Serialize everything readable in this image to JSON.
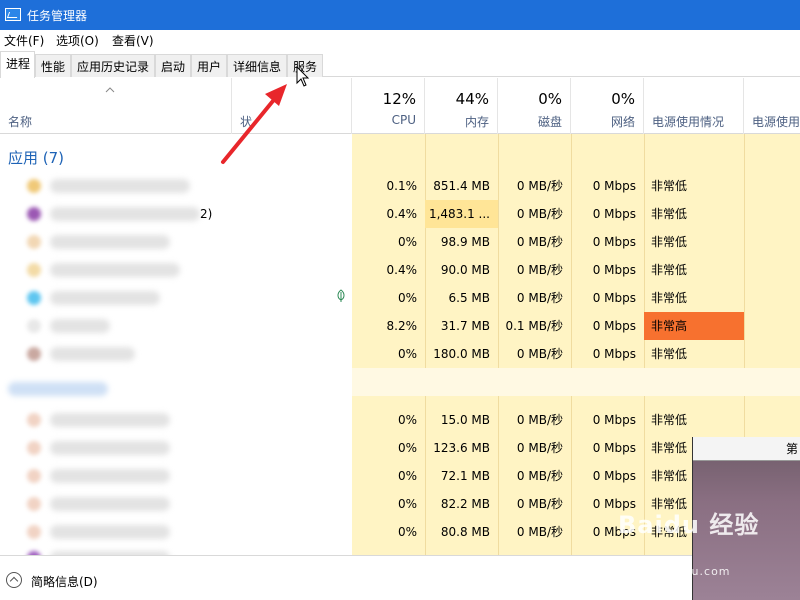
{
  "window": {
    "title": "任务管理器"
  },
  "menu": [
    "文件(F)",
    "选项(O)",
    "查看(V)"
  ],
  "tabs": [
    "进程",
    "性能",
    "应用历史记录",
    "启动",
    "用户",
    "详细信息",
    "服务"
  ],
  "header": {
    "name": "名称",
    "status": "状",
    "cpu_pct": "12%",
    "cpu": "CPU",
    "mem_pct": "44%",
    "mem": "内存",
    "disk_pct": "0%",
    "disk": "磁盘",
    "net_pct": "0%",
    "net": "网络",
    "power": "电源使用情况",
    "power_trend": "电源使用"
  },
  "group": {
    "title": "应用 (7)"
  },
  "name_fragment": "2)",
  "rows": [
    {
      "cpu": "0.1%",
      "mem": "851.4 MB",
      "disk": "0 MB/秒",
      "net": "0 Mbps",
      "power": "非常低"
    },
    {
      "cpu": "0.4%",
      "mem": "1,483.1 ...",
      "disk": "0 MB/秒",
      "net": "0 Mbps",
      "power": "非常低"
    },
    {
      "cpu": "0%",
      "mem": "98.9 MB",
      "disk": "0 MB/秒",
      "net": "0 Mbps",
      "power": "非常低"
    },
    {
      "cpu": "0.4%",
      "mem": "90.0 MB",
      "disk": "0 MB/秒",
      "net": "0 Mbps",
      "power": "非常低"
    },
    {
      "cpu": "0%",
      "mem": "6.5 MB",
      "disk": "0 MB/秒",
      "net": "0 Mbps",
      "power": "非常低"
    },
    {
      "cpu": "8.2%",
      "mem": "31.7 MB",
      "disk": "0.1 MB/秒",
      "net": "0 Mbps",
      "power": "非常高"
    },
    {
      "cpu": "0%",
      "mem": "180.0 MB",
      "disk": "0 MB/秒",
      "net": "0 Mbps",
      "power": "非常低"
    }
  ],
  "rows2": [
    {
      "cpu": "0%",
      "mem": "15.0 MB",
      "disk": "0 MB/秒",
      "net": "0 Mbps",
      "power": "非常低"
    },
    {
      "cpu": "0%",
      "mem": "123.6 MB",
      "disk": "0 MB/秒",
      "net": "0 Mbps",
      "power": "非常低"
    },
    {
      "cpu": "0%",
      "mem": "72.1 MB",
      "disk": "0 MB/秒",
      "net": "0 Mbps",
      "power": "非常低"
    },
    {
      "cpu": "0%",
      "mem": "82.2 MB",
      "disk": "0 MB/秒",
      "net": "0 Mbps",
      "power": "非常低"
    },
    {
      "cpu": "0%",
      "mem": "80.8 MB",
      "disk": "0 MB/秒",
      "net": "0 Mbps",
      "power": "非常低"
    }
  ],
  "footer": {
    "label": "简略信息(D)"
  },
  "overlay": {
    "text": "第"
  },
  "watermark": {
    "text": "Baidu 经验",
    "sub": "jingyan.baidu.com"
  },
  "colors": {
    "titlebar": "#1e6fd9",
    "cell_bg": "#fff4c4",
    "cell_hi": "#ffe597",
    "power_high": "#f7712f",
    "group_title": "#1e63b6",
    "arrow": "#e8262b"
  }
}
